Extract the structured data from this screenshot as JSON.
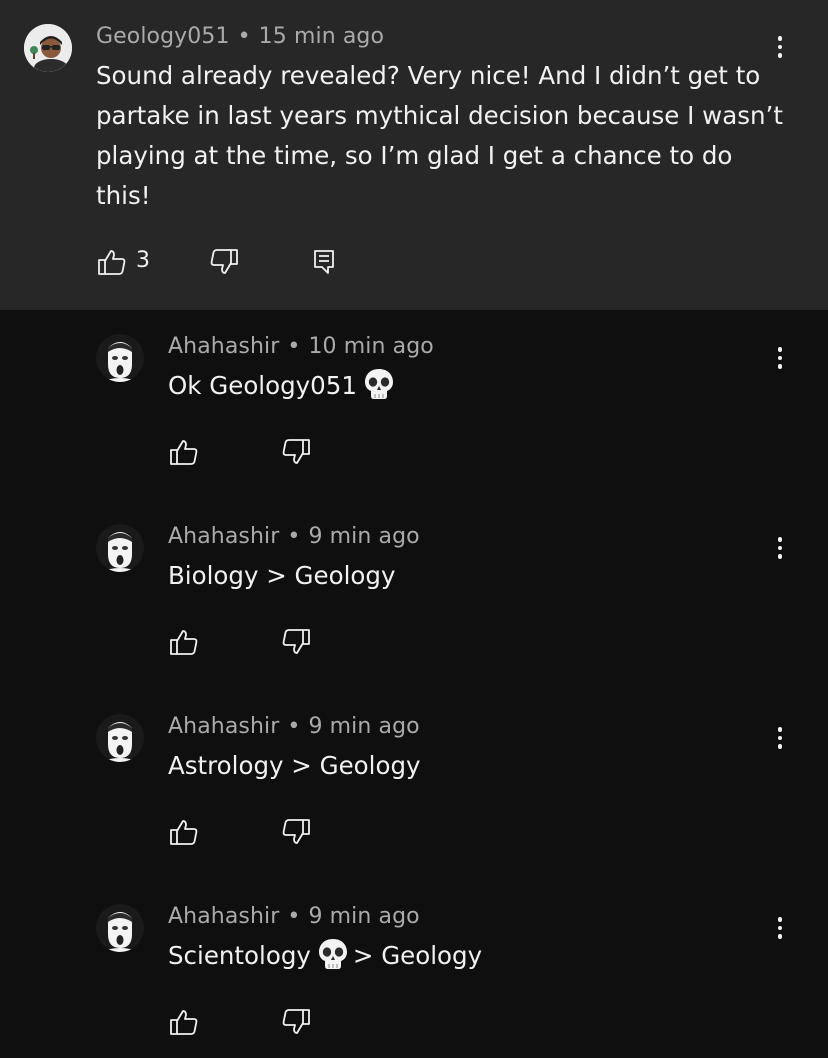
{
  "parent_comment": {
    "author": "Geology051",
    "time": "15 min ago",
    "text": "Sound already revealed? Very nice! And I didn’t get to partake in last years mythical decision because I wasn’t playing at the time, so I’m glad I get a chance to do this!",
    "likes": "3"
  },
  "replies": [
    {
      "author": "Ahahashir",
      "time": "10 min ago",
      "text_before": "Ok Geology051",
      "has_skull": true,
      "text_after": ""
    },
    {
      "author": "Ahahashir",
      "time": "9 min ago",
      "text_before": "Biology > Geology",
      "has_skull": false,
      "text_after": ""
    },
    {
      "author": "Ahahashir",
      "time": "9 min ago",
      "text_before": "Astrology > Geology",
      "has_skull": false,
      "text_after": ""
    },
    {
      "author": "Ahahashir",
      "time": "9 min ago",
      "text_before": "Scientology",
      "has_skull": true,
      "text_after": "> Geology"
    }
  ],
  "separator": "•",
  "icons": {
    "like": "thumbs-up-icon",
    "dislike": "thumbs-down-icon",
    "reply": "reply-comment-icon",
    "more": "more-vertical-icon",
    "emoji": "skull-emoji-icon"
  },
  "colors": {
    "background": "#0f0f0f",
    "highlighted_comment_bg": "#272727",
    "primary_text": "#f1f1f1",
    "secondary_text": "#aaaaaa"
  }
}
